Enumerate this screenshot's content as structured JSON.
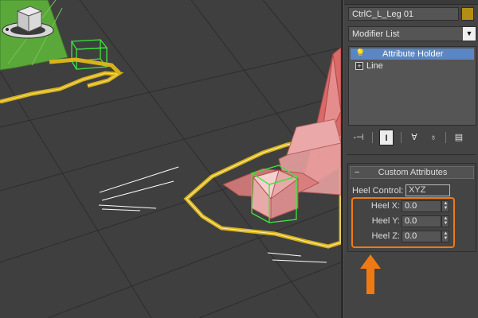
{
  "panel": {
    "object_name": "CtrlC_L_Leg 01",
    "object_color": "#b48d14",
    "modifier_list": "Modifier List",
    "stack": [
      {
        "label": "Attribute Holder",
        "selected": true,
        "icon": "lightbulb-icon"
      },
      {
        "label": "Line",
        "selected": false,
        "icon": "expand-plus-icon"
      }
    ],
    "toolbar_icons": [
      "pin-stack-icon",
      "show-end-result-icon",
      "make-unique-icon",
      "remove-modifier-icon",
      "configure-sets-icon"
    ]
  },
  "rollout": {
    "title": "Custom Attributes",
    "collapse_glyph": "−",
    "heel_control_label": "Heel Control:",
    "heel_control_value": "XYZ",
    "spinners": [
      {
        "label": "Heel X:",
        "value": "0.0"
      },
      {
        "label": "Heel Y:",
        "value": "0.0"
      },
      {
        "label": "Heel Z:",
        "value": "0.0"
      }
    ]
  },
  "colors": {
    "highlight": "#f07a12",
    "selection": "#5a87c3",
    "spline_yellow": "#d8b21a",
    "helper_green": "#3ce63c",
    "foot_red": "#e07a7a"
  }
}
